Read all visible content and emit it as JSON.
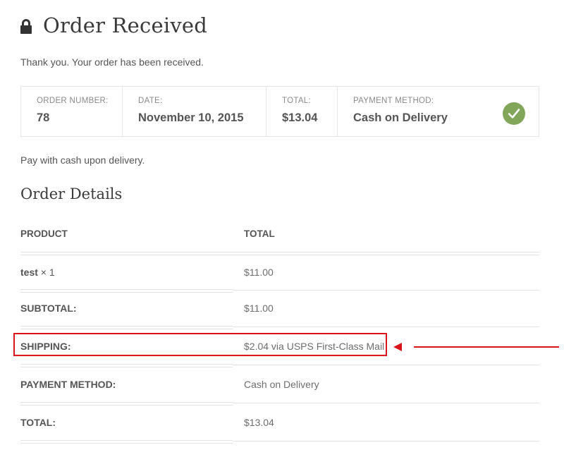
{
  "header": {
    "title": "Order Received"
  },
  "thanks_text": "Thank you. Your order has been received.",
  "overview": [
    {
      "label": "ORDER NUMBER:",
      "value": "78"
    },
    {
      "label": "DATE:",
      "value": "November 10, 2015"
    },
    {
      "label": "TOTAL:",
      "value": "$13.04"
    },
    {
      "label": "PAYMENT METHOD:",
      "value": "Cash on Delivery"
    }
  ],
  "payment_note": "Pay with cash upon delivery.",
  "order_details": {
    "title": "Order Details",
    "headers": {
      "product": "PRODUCT",
      "total": "TOTAL"
    },
    "items": [
      {
        "name": "test",
        "qty": "× 1",
        "total": "$11.00"
      }
    ],
    "subtotal": {
      "label": "SUBTOTAL:",
      "value": "$11.00"
    },
    "shipping": {
      "label": "SHIPPING:",
      "value": "$2.04 via USPS First-Class Mail"
    },
    "payment": {
      "label": "PAYMENT METHOD:",
      "value": "Cash on Delivery"
    },
    "total": {
      "label": "TOTAL:",
      "value": "$13.04"
    }
  },
  "colors": {
    "check": "#81a559",
    "annotation": "#d9141b"
  }
}
